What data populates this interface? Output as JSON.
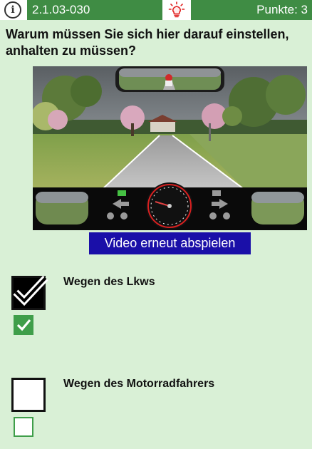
{
  "header": {
    "info_icon": "info-icon",
    "info_glyph": "i",
    "question_id": "2.1.03-030",
    "hint_icon": "lightbulb-icon",
    "points_label": "Punkte: 3",
    "accent_color": "#3f8c44"
  },
  "question": {
    "text": "Warum müssen Sie sich hier darauf einstellen, anhalten zu müssen?"
  },
  "media": {
    "replay_label": "Video erneut abspielen"
  },
  "answers": [
    {
      "label": "Wegen des Lkws",
      "checked": true,
      "confirmed": true
    },
    {
      "label": "Wegen des Motorradfahrers",
      "checked": false,
      "confirmed": false
    }
  ]
}
